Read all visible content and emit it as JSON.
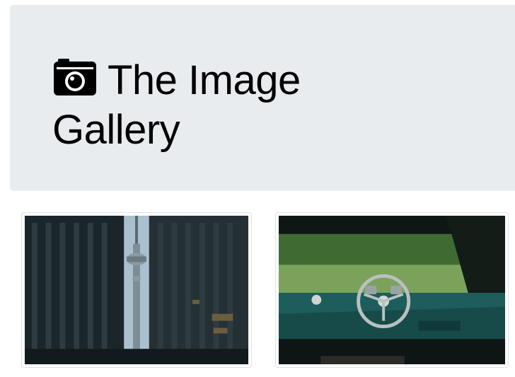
{
  "header": {
    "title": "The Image Gallery",
    "icon": "camera-icon"
  },
  "gallery": {
    "images": [
      {
        "subject": "city-tower",
        "alt": ""
      },
      {
        "subject": "car-dashboard",
        "alt": ""
      }
    ]
  },
  "colors": {
    "jumbotron_bg": "#e9ecef",
    "thumbnail_border": "#dee2e6"
  }
}
